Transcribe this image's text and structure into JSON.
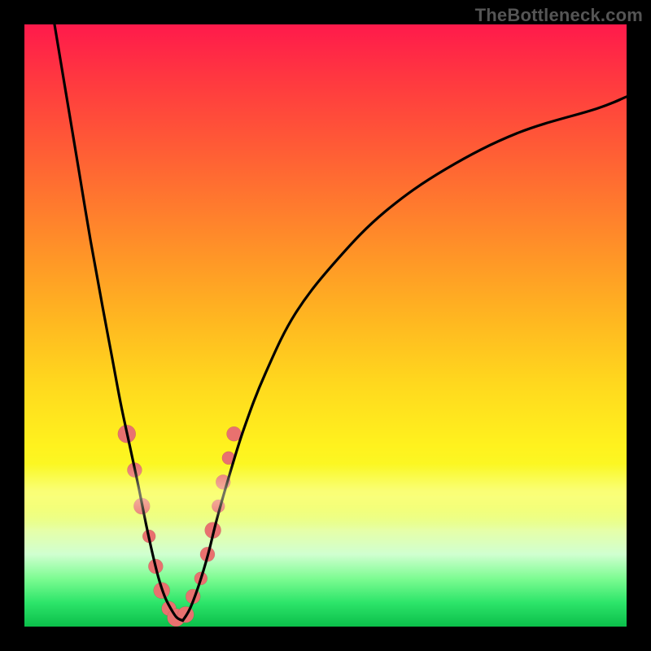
{
  "watermark": "TheBottleneck.com",
  "chart_data": {
    "type": "line",
    "title": "",
    "xlabel": "",
    "ylabel": "",
    "xlim": [
      0,
      100
    ],
    "ylim": [
      0,
      100
    ],
    "grid": false,
    "legend": false,
    "series": [
      {
        "name": "left-curve",
        "x": [
          5,
          7,
          9,
          11,
          13,
          14.5,
          16,
          17.5,
          19,
          20.2,
          21.3,
          22.3,
          23.3,
          24.3,
          25.3,
          26.3
        ],
        "y": [
          100,
          88,
          76,
          64,
          53,
          45,
          37,
          30,
          23,
          17,
          12,
          8,
          5,
          3,
          1.5,
          1
        ]
      },
      {
        "name": "right-curve",
        "x": [
          26.3,
          27.5,
          29,
          30.5,
          32,
          34,
          36.5,
          40,
          45,
          52,
          60,
          70,
          82,
          95,
          100
        ],
        "y": [
          1,
          3,
          7,
          12,
          18,
          25,
          33,
          42,
          52,
          61,
          69,
          76,
          82,
          86,
          88
        ]
      }
    ],
    "markers": [
      {
        "series": "left-curve",
        "x": 17.0,
        "y": 32,
        "r": 11
      },
      {
        "series": "left-curve",
        "x": 18.3,
        "y": 26,
        "r": 9
      },
      {
        "series": "left-curve",
        "x": 19.5,
        "y": 20,
        "r": 10
      },
      {
        "series": "left-curve",
        "x": 20.7,
        "y": 15,
        "r": 8
      },
      {
        "series": "left-curve",
        "x": 21.8,
        "y": 10,
        "r": 9
      },
      {
        "series": "left-curve",
        "x": 22.8,
        "y": 6,
        "r": 10
      },
      {
        "series": "left-curve",
        "x": 24.0,
        "y": 3,
        "r": 9
      },
      {
        "series": "left-curve",
        "x": 25.2,
        "y": 1.5,
        "r": 11
      },
      {
        "series": "right-curve",
        "x": 26.8,
        "y": 2,
        "r": 10
      },
      {
        "series": "right-curve",
        "x": 28.0,
        "y": 5,
        "r": 9
      },
      {
        "series": "right-curve",
        "x": 29.3,
        "y": 8,
        "r": 8
      },
      {
        "series": "right-curve",
        "x": 30.4,
        "y": 12,
        "r": 9
      },
      {
        "series": "right-curve",
        "x": 31.3,
        "y": 16,
        "r": 10
      },
      {
        "series": "right-curve",
        "x": 32.2,
        "y": 20,
        "r": 8
      },
      {
        "series": "right-curve",
        "x": 33.0,
        "y": 24,
        "r": 9
      },
      {
        "series": "right-curve",
        "x": 33.9,
        "y": 28,
        "r": 8
      },
      {
        "series": "right-curve",
        "x": 34.8,
        "y": 32,
        "r": 9
      }
    ],
    "background": {
      "type": "vertical-gradient",
      "stops": [
        {
          "pos": 0.0,
          "color": "#ff1a4b"
        },
        {
          "pos": 0.5,
          "color": "#ffba20"
        },
        {
          "pos": 0.78,
          "color": "#f5ff2a"
        },
        {
          "pos": 1.0,
          "color": "#0bbf4a"
        }
      ]
    }
  }
}
